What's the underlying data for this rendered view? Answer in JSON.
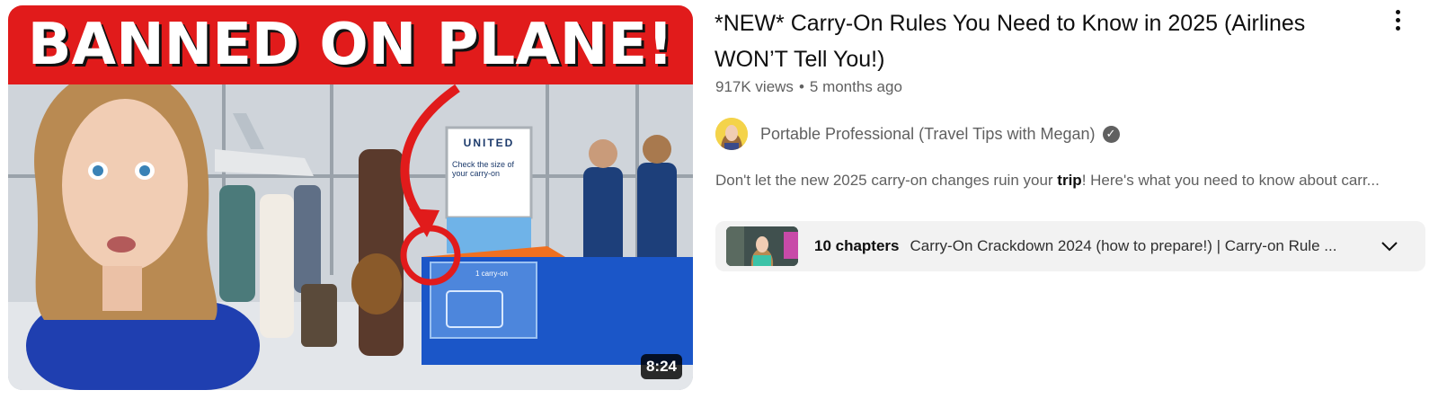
{
  "video": {
    "thumbnail": {
      "banner_text": "BANNED ON PLANE!",
      "sign_brand": "UNITED",
      "sign_line": "Check the size of your carry-on",
      "counter_line": "1 carry-on",
      "duration": "8:24"
    },
    "title": "*NEW* Carry-On Rules You Need to Know in 2025 (Airlines WON’T Tell You!)",
    "views": "917K views",
    "separator": "•",
    "age": "5 months ago",
    "menu_icon": "more-vert-icon",
    "channel": {
      "name": "Portable Professional (Travel Tips with Megan)",
      "verified_icon": "verified-check-icon",
      "verified_glyph": "✓"
    },
    "description": {
      "before": "Don't let the new 2025 carry-on changes ruin your ",
      "highlight": "trip",
      "after": "! Here's what you need to know about carr..."
    },
    "chapters": {
      "count_label": "10 chapters",
      "title": "Carry-On Crackdown 2024 (how to prepare!) | Carry-on Rule ...",
      "expand_icon": "chevron-down-icon"
    }
  },
  "colors": {
    "banner_red": "#e11b1b",
    "text_primary": "#0f0f0f",
    "text_secondary": "#606060",
    "chapters_bg": "#f2f2f2"
  }
}
